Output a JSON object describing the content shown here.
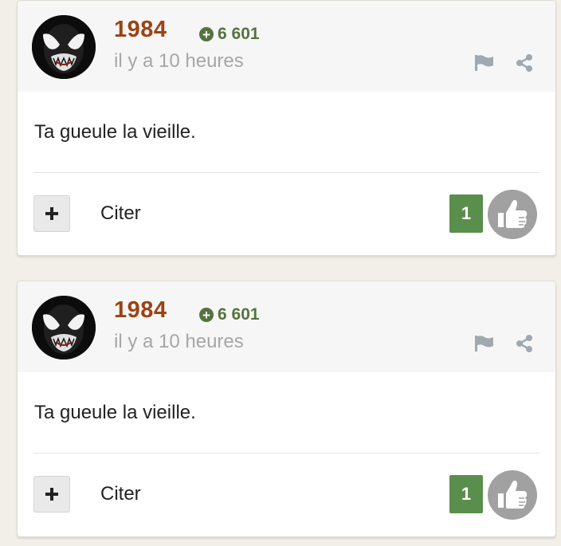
{
  "colors": {
    "username": "#9c4213",
    "points": "#55733e",
    "like_count_bg": "#5a8e4c",
    "like_button_bg": "#a1a1a1",
    "page_bg": "#f2efe9"
  },
  "posts": [
    {
      "author": "1984",
      "avatar_icon": "venom-avatar",
      "points": "6 601",
      "time": "il y a 10 heures",
      "message": "Ta gueule la vieille.",
      "quote_label": "Citer",
      "like_count": "1"
    },
    {
      "author": "1984",
      "avatar_icon": "venom-avatar",
      "points": "6 601",
      "time": "il y a 10 heures",
      "message": "Ta gueule la vieille.",
      "quote_label": "Citer",
      "like_count": "1"
    }
  ]
}
